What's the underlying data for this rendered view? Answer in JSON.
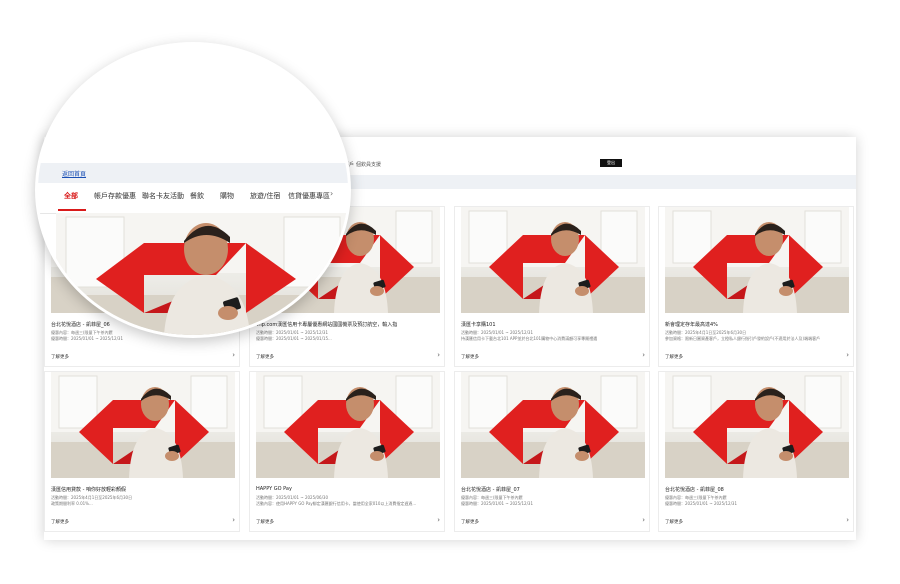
{
  "topbar": {
    "links": [
      "我的帳戶",
      "個欽員支援"
    ],
    "button": "登出"
  },
  "magnifier": {
    "back_link": "返回首頁",
    "tabs": [
      "全部",
      "帳戶存款優惠",
      "聯名卡友活動",
      "餐飲",
      "購物",
      "旅遊/住宿",
      "信貸優惠專區"
    ],
    "active_tab": 0
  },
  "cards": [
    {
      "title": "台北花悅酒店 - 凱菲屋_06",
      "line1": "優惠內容：每週三(限量下午茶內饌",
      "line2": "優惠時間：2025/01/01 ~ 2025/12/31",
      "more": "了解更多"
    },
    {
      "title": "Trip.com漢匯信用卡專屬優惠網站國國機票及預訂航空，輸入指",
      "line1": "活動時間：2025/01/01 ~ 2025/12/31",
      "line2": "優惠時間：2025/01/01 ~ 2025/01/15...",
      "more": "了解更多"
    },
    {
      "title": "漢匯卡享購101",
      "line1": "活動時間：2025/01/01 ~ 2025/12/31",
      "line2": "持漢匯信用卡下載台北101 APP並於台北101購物中心消費滿額可享專屬禮遇",
      "more": "了解更多"
    },
    {
      "title": "新會理定存年最高達4%",
      "line1": "活動時間：2025年4月1日至2025年6月30日",
      "line2": "參加資格：限新日圓資產客戶，立橙私人銀行指引戶發約設戶(不適用於法人及)端端客戶",
      "more": "了解更多"
    },
    {
      "title": "漢匯信用貸款 - 咱你好放輕彩顏假",
      "line1": "活動時間：2025年4月1日至2025年6月30日",
      "line2": "政策期間利率 0.01%...",
      "more": "了解更多"
    },
    {
      "title": "HAPPY GO Pay",
      "line1": "活動時間：2025/01/01 ~ 2025/06/30",
      "line2": "活動內容：使用HAPPY GO Pay綁定漢匯銀行信用卡，當使用全家010以上消費指定週過...",
      "more": "了解更多"
    },
    {
      "title": "台北花悅酒店 - 凱菲屋_07",
      "line1": "優惠內容：每週三(限量下午茶內饌",
      "line2": "優惠時間：2025/01/01 ~ 2025/12/31",
      "more": "了解更多"
    },
    {
      "title": "台北花悅酒店 - 凱菲屋_08",
      "line1": "優惠內容：每週三(限量下午茶內饌",
      "line2": "優惠時間：2025/01/01 ~ 2025/12/31",
      "more": "了解更多"
    }
  ],
  "colors": {
    "accent_red": "#d91a1a",
    "link_blue": "#1a4fb5",
    "subbar": "#eef1f5"
  },
  "icons": {
    "card_arrow": "chevron-right-icon",
    "tabs_more": "chevron-right-icon"
  }
}
